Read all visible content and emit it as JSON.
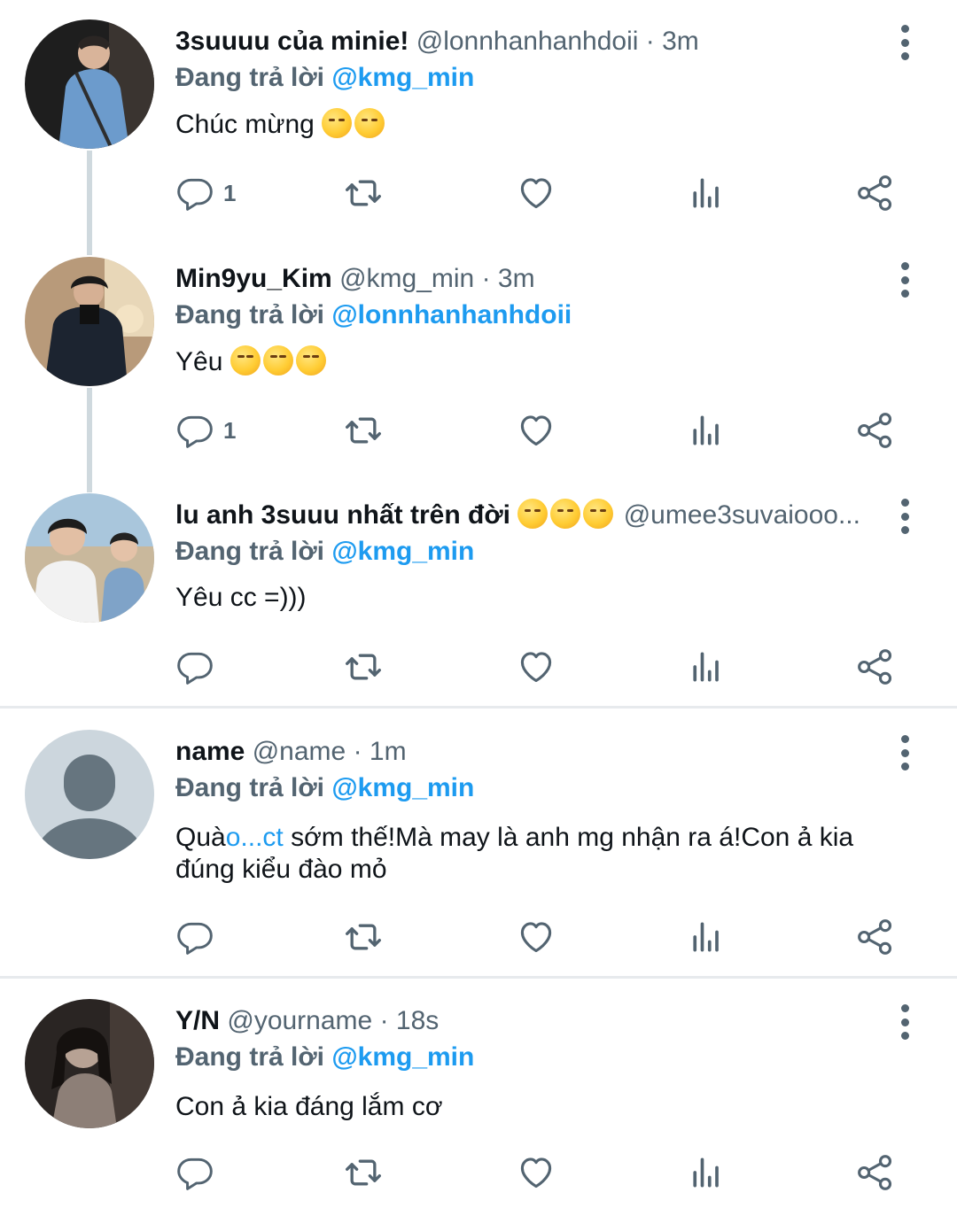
{
  "replying_label": "Đang trả lời",
  "tweets": [
    {
      "name": "3suuuu của minie!",
      "handle": "@lonnhanhanhdoii",
      "dot": "·",
      "time": "3m",
      "replying_to": "@kmg_min",
      "text": "Chúc mừng",
      "emoji": [
        "hugging-face",
        "hugging-face"
      ],
      "reply_count": "1"
    },
    {
      "name": "Min9yu_Kim",
      "handle": "@kmg_min",
      "dot": "·",
      "time": "3m",
      "replying_to": "@lonnhanhanhdoii",
      "text": "Yêu",
      "emoji": [
        "kissing-face",
        "kissing-face",
        "kissing-face"
      ],
      "reply_count": "1"
    },
    {
      "name": "lu anh 3suuu nhất trên đời",
      "name_emoji": [
        "hugging-face",
        "hugging-face",
        "hugging-face"
      ],
      "handle": "@umee3suvaiooo...",
      "replying_to": "@kmg_min",
      "text": "Yêu cc =)))",
      "reply_count": ""
    },
    {
      "name": "name",
      "handle": "@name",
      "dot": "·",
      "time": "1m",
      "replying_to": "@kmg_min",
      "text_before": "Quà",
      "text_link": "o...ct",
      "text_after": " sớm thế!Mà may là anh mg nhận ra á!Con ả kia đúng kiểu đào mỏ",
      "reply_count": ""
    },
    {
      "name": "Y/N",
      "handle": "@yourname",
      "dot": "·",
      "time": "18s",
      "replying_to": "@kmg_min",
      "text": "Con ả kia đáng lắm cơ",
      "reply_count": ""
    }
  ],
  "colors": {
    "accent": "#1d9bf0",
    "secondary_text": "#536471",
    "thread_line": "#cfd9de",
    "divider": "#e7eaed"
  },
  "icons": [
    "reply-icon",
    "retweet-icon",
    "like-icon",
    "views-icon",
    "share-icon",
    "more-icon"
  ]
}
